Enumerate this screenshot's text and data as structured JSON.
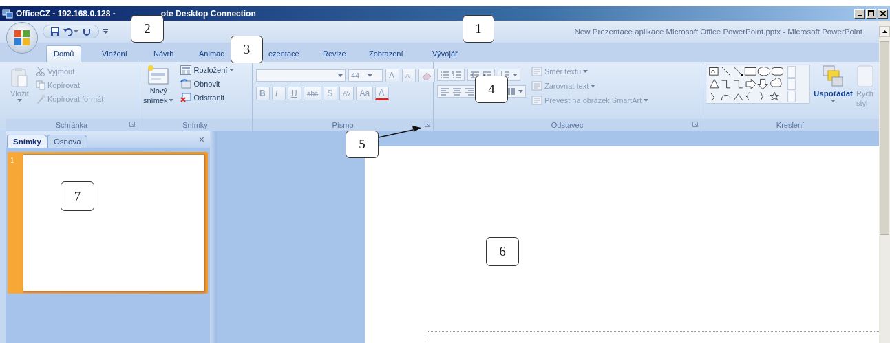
{
  "remote_window": {
    "title_start": "OfficeCZ - 192.168.0.128 -",
    "title_end": "ote Desktop Connection"
  },
  "app_title": "New Prezentace aplikace Microsoft Office PowerPoint.pptx - Microsoft PowerPoint",
  "tabs": [
    {
      "label": "Domů",
      "selected": true
    },
    {
      "label": "Vložení",
      "selected": false
    },
    {
      "label": "Návrh",
      "selected": false
    },
    {
      "label": "Animac",
      "selected": false
    },
    {
      "label": "ezentace",
      "selected": false
    },
    {
      "label": "Revize",
      "selected": false
    },
    {
      "label": "Zobrazení",
      "selected": false
    },
    {
      "label": "Vývojář",
      "selected": false
    }
  ],
  "ribbon_groups": [
    {
      "kind": "clipboard",
      "label": "Schránka",
      "launcher": true,
      "paste": {
        "label": "Vložit",
        "disabled": true
      },
      "commands": [
        {
          "label": "Vyjmout",
          "disabled": true
        },
        {
          "label": "Kopírovat",
          "disabled": true
        },
        {
          "label": "Kopírovat formát",
          "disabled": true
        }
      ]
    },
    {
      "kind": "slides",
      "label": "Snímky",
      "launcher": false,
      "new_slide": {
        "label_line_1": "Nový",
        "label_line_2": "snímek",
        "disabled": false
      },
      "commands": [
        {
          "label": "Rozložení",
          "dropdown": true,
          "disabled": false
        },
        {
          "label": "Obnovit",
          "dropdown": false,
          "disabled": false
        },
        {
          "label": "Odstranit",
          "dropdown": false,
          "disabled": false
        }
      ]
    },
    {
      "kind": "font",
      "label": "Písmo",
      "launcher": true,
      "disabled": true,
      "font_size": "44",
      "size_buttons": [
        {
          "label": "A",
          "kind": "grow"
        },
        {
          "label": "A",
          "kind": "shrink"
        }
      ],
      "format_buttons": [
        {
          "label": "B",
          "kind": "bold"
        },
        {
          "label": "I",
          "kind": "italic"
        },
        {
          "label": "U",
          "kind": "underline"
        },
        {
          "label": "abc",
          "kind": "strikethrough"
        },
        {
          "label": "S",
          "kind": "shadow"
        },
        {
          "label": "AV",
          "kind": "spacing"
        },
        {
          "label": "Aa",
          "kind": "case"
        },
        {
          "label": "A",
          "kind": "color"
        }
      ]
    },
    {
      "kind": "paragraph",
      "label": "Odstavec",
      "launcher": true,
      "commands": [
        {
          "label": "Směr textu",
          "disabled": true
        },
        {
          "label": "Zarovnat text",
          "disabled": true
        },
        {
          "label": "Převést na obrázek SmartArt",
          "disabled": true
        }
      ]
    },
    {
      "kind": "drawing",
      "label": "Kreslení",
      "launcher": false,
      "arrange": {
        "label": "Uspořádat",
        "disabled": false
      },
      "quick_styles": {
        "label_line_1": "Rych",
        "label_line_2": "styl",
        "disabled": true
      }
    }
  ],
  "slides_pane": {
    "tabs": [
      {
        "label": "Snímky",
        "selected": true
      },
      {
        "label": "Osnova",
        "selected": false
      }
    ],
    "close": "×",
    "thumbnails": [
      {
        "number": "1",
        "selected": true
      }
    ]
  },
  "callouts": [
    {
      "text": "1",
      "arrow": false
    },
    {
      "text": "2",
      "arrow": false
    },
    {
      "text": "3",
      "arrow": false
    },
    {
      "text": "4",
      "arrow": false
    },
    {
      "text": "5",
      "arrow": true
    },
    {
      "text": "6",
      "arrow": false
    },
    {
      "text": "7",
      "arrow": false
    }
  ]
}
